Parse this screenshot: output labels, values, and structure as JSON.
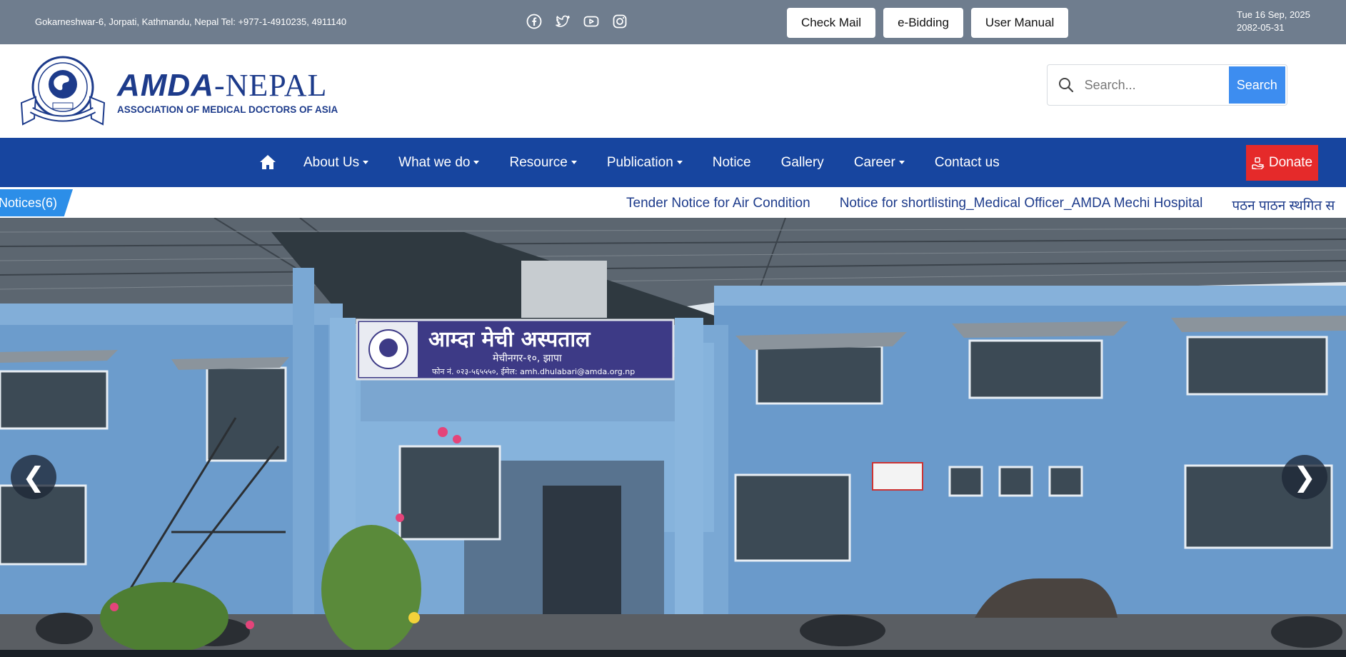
{
  "topbar": {
    "address": "Gokarneshwar-6, Jorpati, Kathmandu, Nepal Tel: +977-1-4910235, 4911140",
    "social_icons": [
      "facebook-icon",
      "twitter-icon",
      "youtube-icon",
      "instagram-icon"
    ],
    "buttons": {
      "check_mail": "Check Mail",
      "e_bidding": "e-Bidding",
      "user_manual": "User Manual"
    },
    "date_en": "Tue 16 Sep, 2025",
    "date_np": "2082-05-31"
  },
  "header": {
    "brand_bold": "AMDA",
    "brand_rest": "-NEPAL",
    "subtitle": "ASSOCIATION OF MEDICAL DOCTORS OF ASIA",
    "logo_caption": "AMDA-Nepal",
    "search": {
      "placeholder": "Search...",
      "button_label": "Search"
    }
  },
  "nav": {
    "items": [
      {
        "label": "About Us",
        "dropdown": true
      },
      {
        "label": "What we do",
        "dropdown": true
      },
      {
        "label": "Resource",
        "dropdown": true
      },
      {
        "label": "Publication",
        "dropdown": true
      },
      {
        "label": "Notice",
        "dropdown": false
      },
      {
        "label": "Gallery",
        "dropdown": false
      },
      {
        "label": "Career",
        "dropdown": true
      },
      {
        "label": "Contact us",
        "dropdown": false
      }
    ],
    "donate_label": "Donate"
  },
  "notices": {
    "tag": "Notices(6)",
    "items": [
      "Tender Notice for Air Condition",
      "Notice for shortlisting_Medical Officer_AMDA Mechi Hospital",
      "पठन पाठन स्थगित स"
    ]
  },
  "hero": {
    "signboard_title": "आम्दा मेची अस्पताल",
    "signboard_sub": "मेचीनगर-१०, झापा",
    "signboard_contact": "फोन नं. ०२३-५६५५५०, ईमेल: amh.dhulabari@amda.org.np",
    "prev_glyph": "❮",
    "next_glyph": "❯"
  },
  "colors": {
    "topbar": "#6f7d8e",
    "nav": "#17459f",
    "brand": "#1d3b8b",
    "search_button": "#3d8df0",
    "donate": "#e52a2a",
    "notice_tag": "#2c8ee8"
  }
}
